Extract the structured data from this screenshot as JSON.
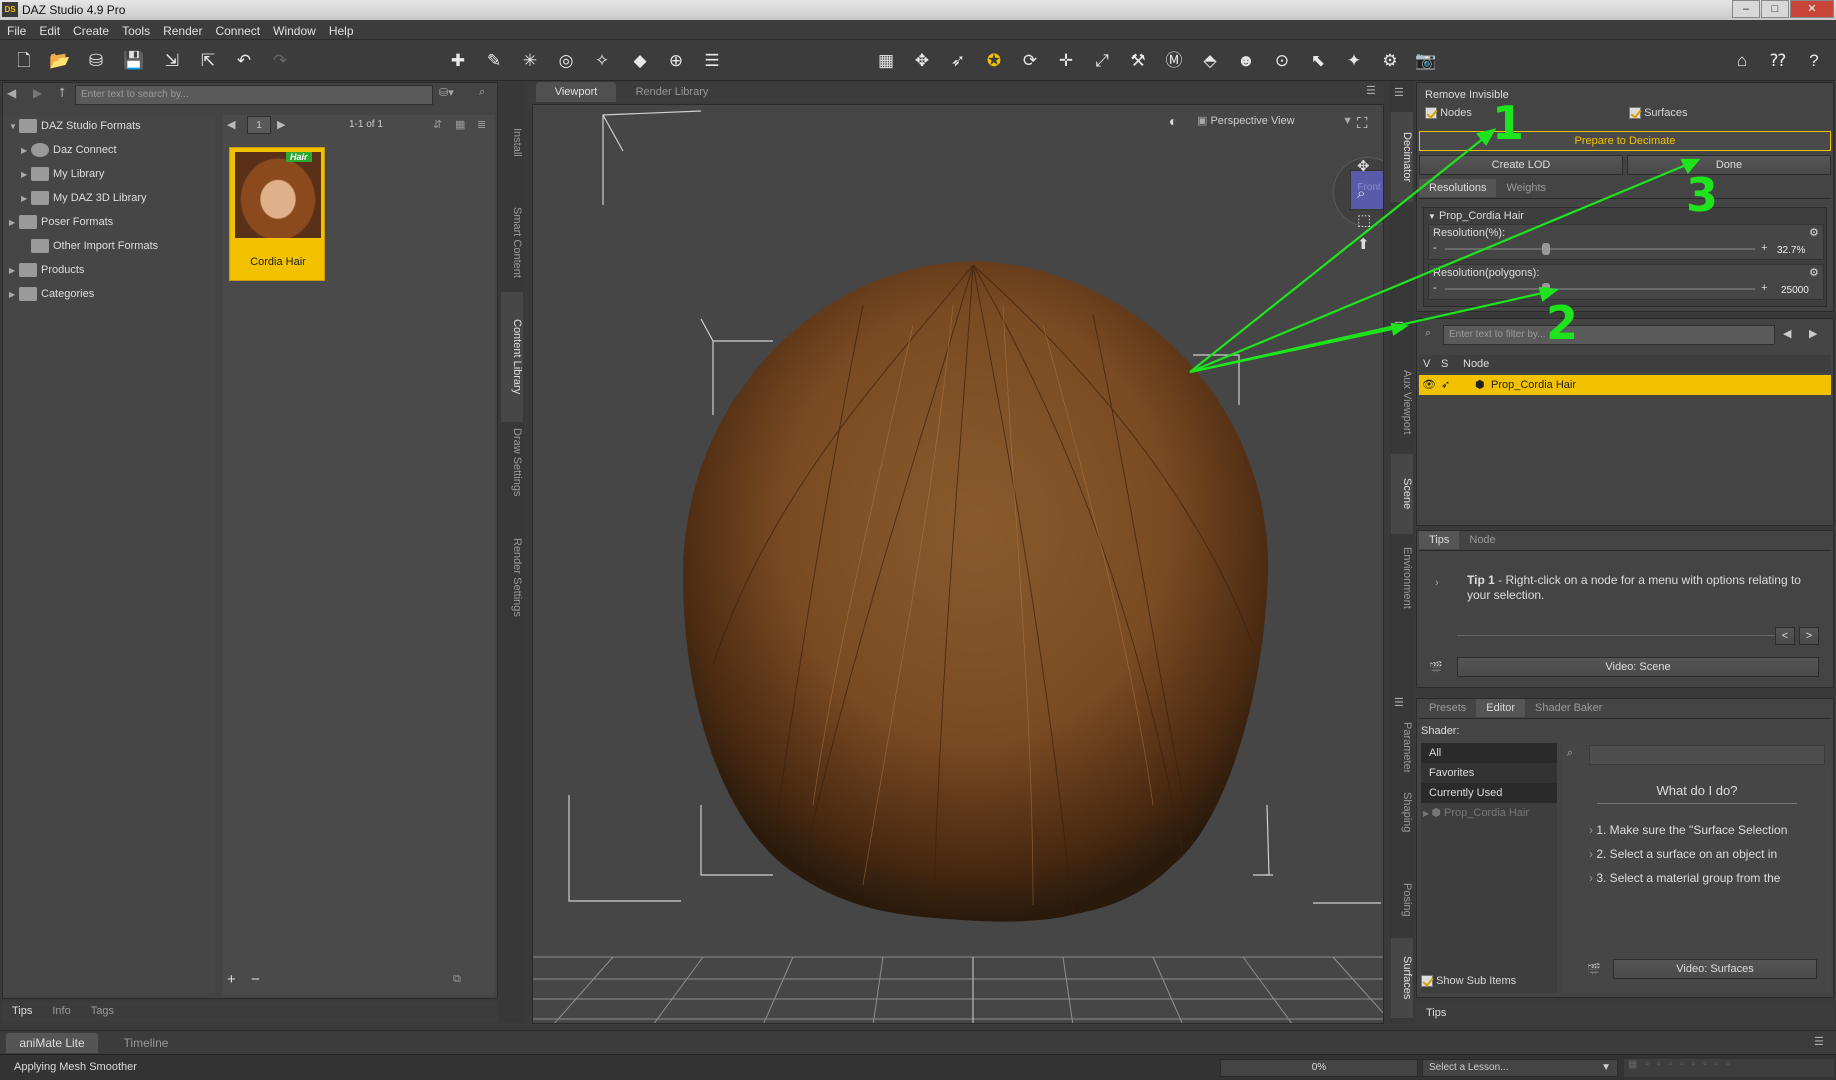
{
  "app": {
    "title": "DAZ Studio 4.9 Pro",
    "logo": "DS"
  },
  "menu": [
    "File",
    "Edit",
    "Create",
    "Tools",
    "Render",
    "Connect",
    "Window",
    "Help"
  ],
  "content_library": {
    "search_placeholder": "Enter text to search by...",
    "tree": [
      "DAZ Studio Formats",
      "Daz Connect",
      "My Library",
      "My DAZ 3D Library",
      "Poser Formats",
      "Other Import Formats",
      "Products",
      "Categories"
    ],
    "page_number": "1",
    "page_count": "1-1 of 1",
    "item": {
      "label": "Cordia Hair",
      "badge": "Hair"
    },
    "bottom_tabs": [
      "Tips",
      "Info",
      "Tags"
    ]
  },
  "left_vertical_tabs": [
    "Install",
    "Smart Content",
    "Content Library",
    "Draw Settings",
    "Render Settings"
  ],
  "viewport": {
    "tabs": [
      "Viewport",
      "Render Library"
    ],
    "view_mode": "Perspective View",
    "cube_label": "Front"
  },
  "decimator": {
    "vertical_tab": "Decimator",
    "remove_invisible": "Remove Invisible",
    "nodes_label": "Nodes",
    "surfaces_label": "Surfaces",
    "prepare_button": "Prepare to Decimate",
    "create_lod_button": "Create LOD",
    "done_button": "Done",
    "tabs": [
      "Resolutions",
      "Weights"
    ],
    "node_name": "Prop_Cordia Hair",
    "resolution_pct_label": "Resolution(%):",
    "resolution_pct_value": "32.7%",
    "resolution_pct_fraction": 0.327,
    "resolution_poly_label": "Resolution(polygons):",
    "resolution_poly_value": "25000",
    "resolution_poly_fraction": 0.327
  },
  "scene": {
    "filter_placeholder": "Enter text to filter by...",
    "columns": [
      "V",
      "S",
      "Node"
    ],
    "selected_node": "Prop_Cordia Hair"
  },
  "right_vertical_tabs": [
    "Aux Viewport",
    "Scene",
    "Environment",
    "Parameters",
    "Shaping",
    "Posing",
    "Surfaces"
  ],
  "tips_panel": {
    "tabs": [
      "Tips",
      "Node"
    ],
    "tip_title": "Tip 1",
    "tip_text": " - Right-click on a node for a menu with options relating to your selection.",
    "video_button": "Video: Scene"
  },
  "surfaces": {
    "tabs": [
      "Presets",
      "Editor",
      "Shader Baker"
    ],
    "shader_label": "Shader:",
    "list": [
      "All",
      "Favorites",
      "Currently Used"
    ],
    "tree_item": "Prop_Cordia Hair",
    "help_title": "What do I do?",
    "steps": [
      "1. Make sure the \"Surface Selection",
      "2. Select a surface on an object in",
      "3. Select a material group from the"
    ],
    "show_sub_items": "Show Sub Items",
    "video_button": "Video: Surfaces",
    "bottom_tab": "Tips"
  },
  "timeline": {
    "tabs": [
      "aniMate Lite",
      "Timeline"
    ]
  },
  "status": {
    "message": "Applying Mesh Smoother",
    "progress_text": "0%",
    "progress": 0,
    "lesson_select": "Select a Lesson..."
  },
  "annotations": [
    "1",
    "2",
    "3"
  ],
  "colors": {
    "accent": "#f2c200",
    "annotation": "#1de41d",
    "panel": "#444444",
    "viewport": "#464646"
  }
}
